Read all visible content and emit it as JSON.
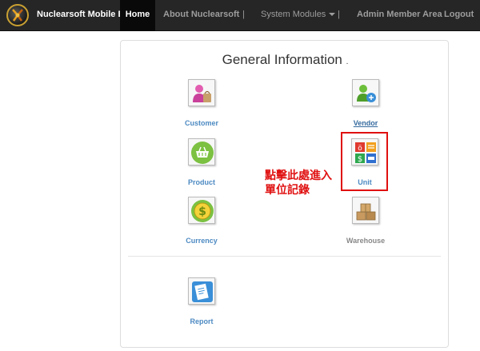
{
  "navbar": {
    "brand": "Nuclearsoft Mobile ERP",
    "items": [
      {
        "label": "Home"
      },
      {
        "label": "About Nuclearsoft"
      },
      {
        "label": "System Modules"
      },
      {
        "label": "Admin Member Area"
      },
      {
        "label": "Logout"
      }
    ],
    "separator": "|"
  },
  "panel": {
    "title": "General Information",
    "title_suffix": ".",
    "modules": [
      {
        "label": "Customer",
        "icon": "customer-icon"
      },
      {
        "label": "Vendor",
        "icon": "vendor-icon"
      },
      {
        "label": "Product",
        "icon": "basket-icon"
      },
      {
        "label": "Unit",
        "icon": "unit-icon"
      },
      {
        "label": "Currency",
        "icon": "dollar-icon"
      },
      {
        "label": "Warehouse",
        "icon": "boxes-icon"
      },
      {
        "label": "Report",
        "icon": "report-icon"
      }
    ]
  },
  "annotation": {
    "line1": "點擊此處進入",
    "line2": "單位記錄",
    "color": "#e01010"
  }
}
